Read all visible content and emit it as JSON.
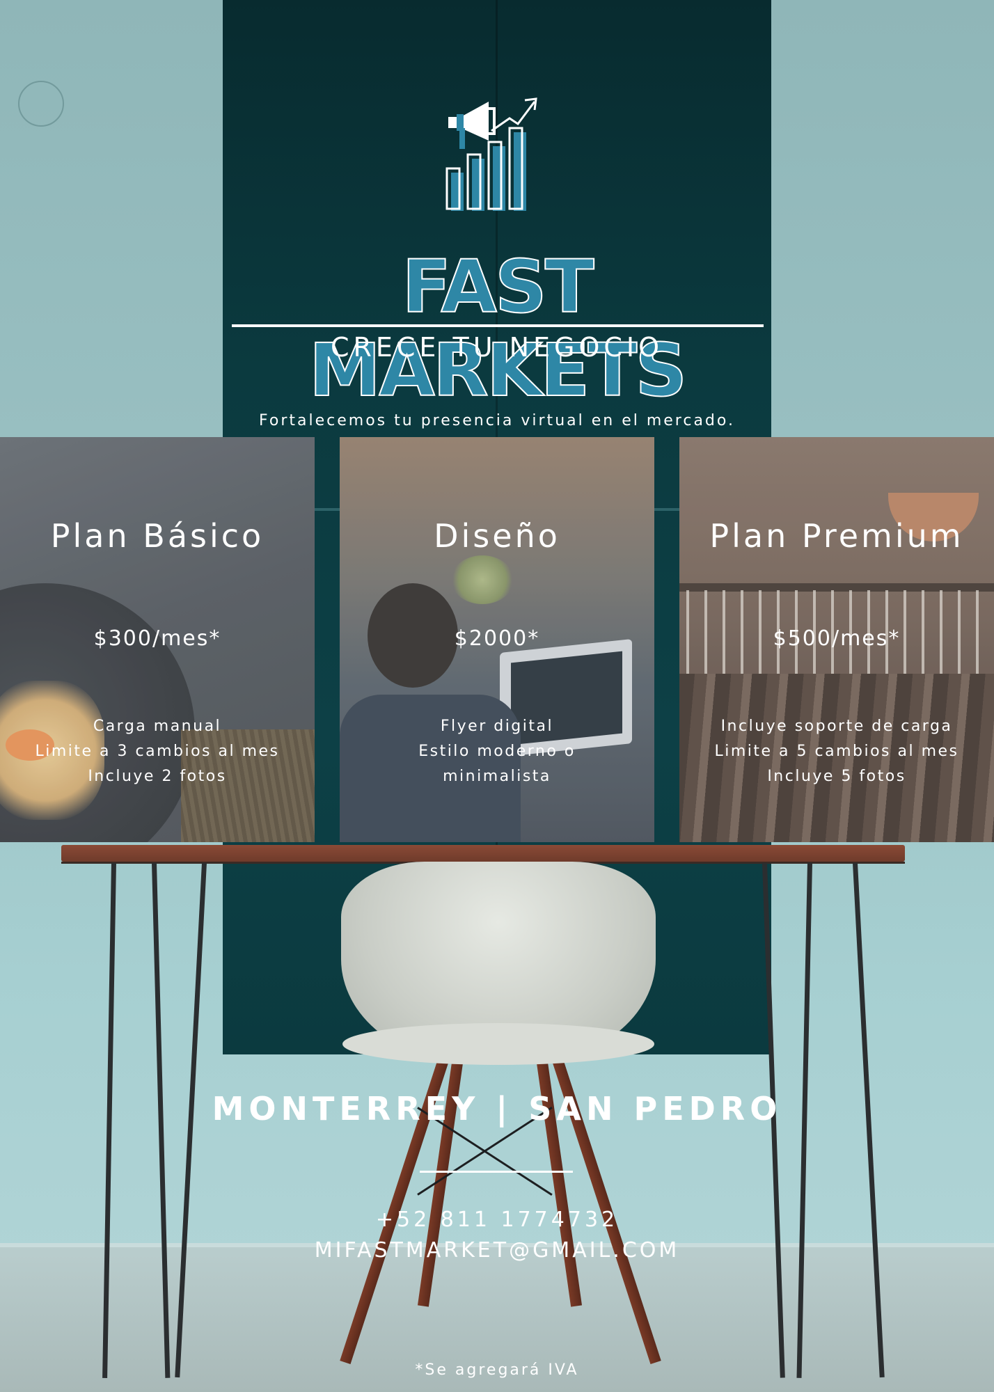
{
  "brand": {
    "title": "FAST MARKETS",
    "subtitle": "CRECE TU NEGOCIO",
    "tagline": "Fortalecemos tu presencia virtual en el mercado.",
    "logo_icon": "megaphone-growth-chart-icon",
    "accent_color": "#2e87a6"
  },
  "plans": [
    {
      "title": "Plan Básico",
      "price": "$300/mes*",
      "features": [
        "Carga manual",
        "Limite a 3 cambios al mes",
        "Incluye 2 fotos"
      ]
    },
    {
      "title": "Diseño",
      "price": "$2000*",
      "features": [
        "Flyer digital",
        "Estilo moderno o",
        "minimalista"
      ]
    },
    {
      "title": "Plan Premium",
      "price": "$500/mes*",
      "features": [
        "Incluye soporte de carga",
        "Limite a 5 cambios al mes",
        "Incluye 5 fotos"
      ]
    }
  ],
  "footer": {
    "location": "MONTERREY | SAN PEDRO",
    "phone": "+52 811 1774732",
    "email": "MIFASTMARKET@GMAIL.COM",
    "note": "*Se agregará IVA"
  }
}
